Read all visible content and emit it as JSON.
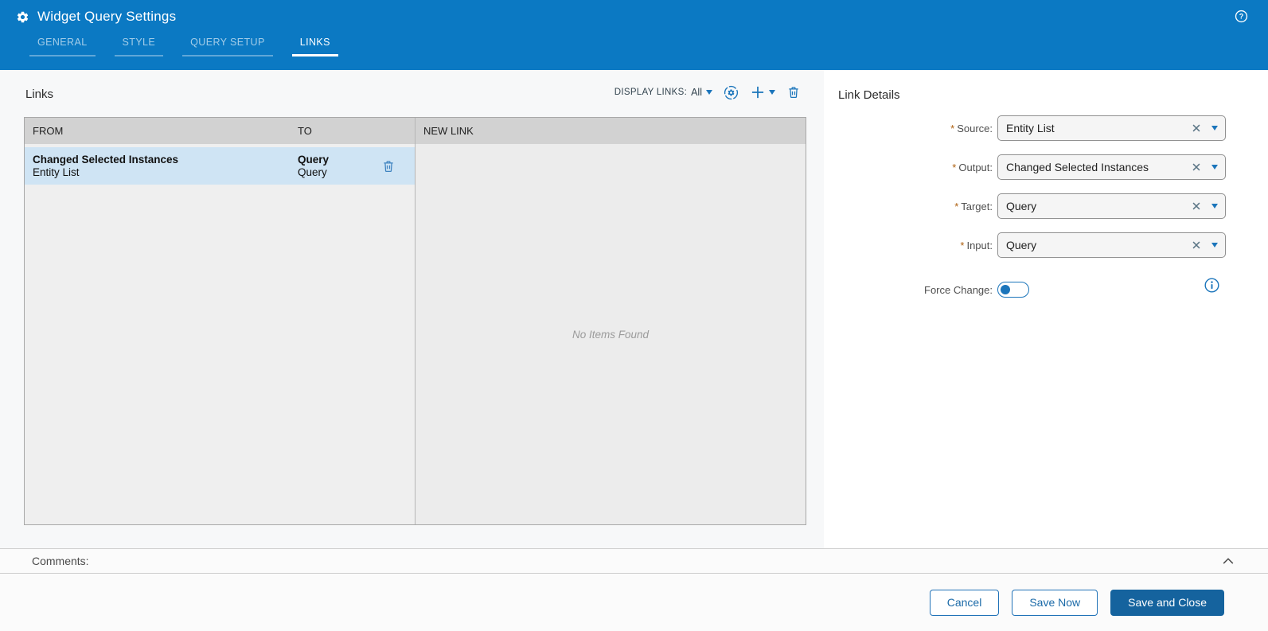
{
  "header": {
    "title": "Widget Query Settings",
    "tabs": [
      {
        "label": "GENERAL",
        "active": false
      },
      {
        "label": "STYLE",
        "active": false
      },
      {
        "label": "QUERY SETUP",
        "active": false
      },
      {
        "label": "LINKS",
        "active": true
      }
    ],
    "help_icon": "question-mark-circle"
  },
  "links_section": {
    "title": "Links",
    "toolbar": {
      "display_links_label": "DISPLAY LINKS:",
      "display_links_value": "All",
      "icons": [
        "auto-link-settings-icon",
        "add-link-icon",
        "delete-link-icon"
      ]
    },
    "table": {
      "columns": [
        "FROM",
        "TO"
      ],
      "new_link_header": "NEW LINK",
      "rows": [
        {
          "from_primary": "Changed Selected Instances",
          "from_secondary": "Entity List",
          "to_primary": "Query",
          "to_secondary": "Query",
          "selected": true
        }
      ],
      "empty_text": "No Items Found"
    }
  },
  "link_details": {
    "title": "Link Details",
    "required_marker": "*",
    "fields": [
      {
        "label": "Source:",
        "value": "Entity List",
        "required": true
      },
      {
        "label": "Output:",
        "value": "Changed Selected Instances",
        "required": true
      },
      {
        "label": "Target:",
        "value": "Query",
        "required": true
      },
      {
        "label": "Input:",
        "value": "Query",
        "required": true
      }
    ],
    "force_change": {
      "label": "Force Change:",
      "enabled": false
    }
  },
  "comments": {
    "label": "Comments:"
  },
  "footer": {
    "buttons": [
      {
        "label": "Cancel",
        "style": "outline"
      },
      {
        "label": "Save Now",
        "style": "outline"
      },
      {
        "label": "Save and Close",
        "style": "primary"
      }
    ]
  },
  "colors": {
    "header_blue": "#0b79c3",
    "accent_blue": "#1b75bb",
    "primary_button_blue": "#15639e",
    "selected_row_blue": "#cfe4f4",
    "table_header_gray": "#d2d2d2",
    "required_marker_orange": "#ad5f0e"
  }
}
